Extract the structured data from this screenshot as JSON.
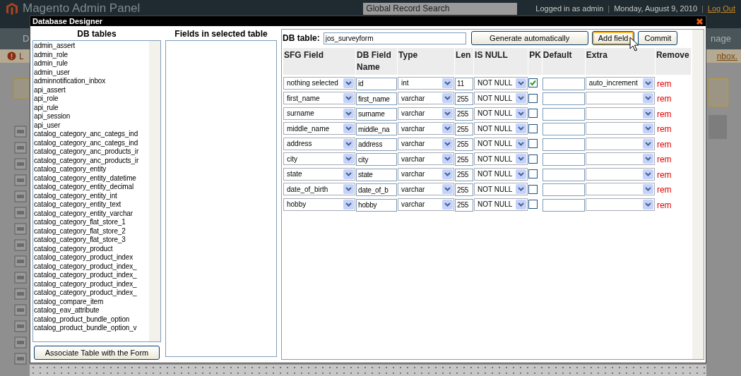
{
  "background_page": {
    "logo": "Magento Admin Panel",
    "search_placeholder": "Global Record Search",
    "user": "Logged in as admin",
    "date": "Monday, August 9, 2010",
    "logout": "Log Out",
    "separators": [
      "|",
      "|"
    ],
    "nav_left": "D",
    "nav_right": "nage",
    "notice_left": "L",
    "notice_right": "nbox."
  },
  "dialog": {
    "title": "Database Designer"
  },
  "tables_panel": {
    "heading": "DB tables",
    "button": "Associate Table with the Form",
    "items": [
      {
        "label": "admin_assert",
        "selected": false
      },
      {
        "label": "admin_role",
        "selected": false
      },
      {
        "label": "admin_rule",
        "selected": false
      },
      {
        "label": "admin_user",
        "selected": false
      },
      {
        "label": "adminnotification_inbox",
        "selected": false
      },
      {
        "label": "api_assert",
        "selected": false
      },
      {
        "label": "api_role",
        "selected": false
      },
      {
        "label": "api_rule",
        "selected": false
      },
      {
        "label": "api_session",
        "selected": false
      },
      {
        "label": "api_user",
        "selected": false
      },
      {
        "label": "catalog_category_anc_categs_ind",
        "selected": false
      },
      {
        "label": "catalog_category_anc_categs_ind",
        "selected": false
      },
      {
        "label": "catalog_category_anc_products_ir",
        "selected": false
      },
      {
        "label": "catalog_category_anc_products_ir",
        "selected": false
      },
      {
        "label": "catalog_category_entity",
        "selected": false
      },
      {
        "label": "catalog_category_entity_datetime",
        "selected": false
      },
      {
        "label": "catalog_category_entity_decimal",
        "selected": false
      },
      {
        "label": "catalog_category_entity_int",
        "selected": false
      },
      {
        "label": "catalog_category_entity_text",
        "selected": false
      },
      {
        "label": "catalog_category_entity_varchar",
        "selected": false
      },
      {
        "label": "catalog_category_flat_store_1",
        "selected": false
      },
      {
        "label": "catalog_category_flat_store_2",
        "selected": false
      },
      {
        "label": "catalog_category_flat_store_3",
        "selected": false
      },
      {
        "label": "catalog_category_product",
        "selected": false
      },
      {
        "label": "catalog_category_product_index",
        "selected": false
      },
      {
        "label": "catalog_category_product_index_",
        "selected": false
      },
      {
        "label": "catalog_category_product_index_",
        "selected": false
      },
      {
        "label": "catalog_category_product_index_",
        "selected": false
      },
      {
        "label": "catalog_category_product_index_",
        "selected": false
      },
      {
        "label": "catalog_compare_item",
        "selected": false
      },
      {
        "label": "catalog_eav_attribute",
        "selected": false
      },
      {
        "label": "catalog_product_bundle_option",
        "selected": false
      },
      {
        "label": "catalog_product_bundle_option_v",
        "selected": false
      }
    ]
  },
  "fields_panel": {
    "heading": "Fields in selected table"
  },
  "designer": {
    "table_label": "DB table:",
    "table_name": "jos_surveyform",
    "buttons": [
      {
        "label": "Generate automatically",
        "focused": false
      },
      {
        "label": "Add field",
        "focused": true
      },
      {
        "label": "Commit",
        "focused": false
      }
    ],
    "columns": [
      "SFG Field",
      "DB Field Name",
      "Type",
      "Len",
      "IS NULL",
      "PK",
      "Default",
      "Extra",
      "Remove"
    ],
    "rows": [
      {
        "sfg_field": "nothing selected",
        "db_field": "id",
        "type": "int",
        "length": "11",
        "is_null": "NOT NULL",
        "pk": true,
        "extra": "auto_increment",
        "remove": "rem"
      },
      {
        "sfg_field": "first_name",
        "db_field": "first_name",
        "type": "varchar",
        "length": "255",
        "is_null": "NOT NULL",
        "pk": false,
        "remove": "rem"
      },
      {
        "sfg_field": "surname",
        "db_field": "surname",
        "type": "varchar",
        "length": "255",
        "is_null": "NOT NULL",
        "pk": false,
        "remove": "rem"
      },
      {
        "sfg_field": "middle_name",
        "db_field": "middle_na",
        "type": "varchar",
        "length": "255",
        "is_null": "NOT NULL",
        "pk": false,
        "remove": "rem"
      },
      {
        "sfg_field": "address",
        "db_field": "address",
        "type": "varchar",
        "length": "255",
        "is_null": "NOT NULL",
        "pk": false,
        "remove": "rem"
      },
      {
        "sfg_field": "city",
        "db_field": "city",
        "type": "varchar",
        "length": "255",
        "is_null": "NOT NULL",
        "pk": false,
        "remove": "rem"
      },
      {
        "sfg_field": "state",
        "db_field": "state",
        "type": "varchar",
        "length": "255",
        "is_null": "NOT NULL",
        "pk": false,
        "remove": "rem"
      },
      {
        "sfg_field": "date_of_birth",
        "db_field": "date_of_b",
        "type": "varchar",
        "length": "255",
        "is_null": "NOT NULL",
        "pk": false,
        "remove": "rem"
      },
      {
        "sfg_field": "hobby",
        "db_field": "hobby",
        "type": "varchar",
        "length": "255",
        "is_null": "NOT NULL",
        "pk": false,
        "remove": "rem"
      }
    ]
  }
}
